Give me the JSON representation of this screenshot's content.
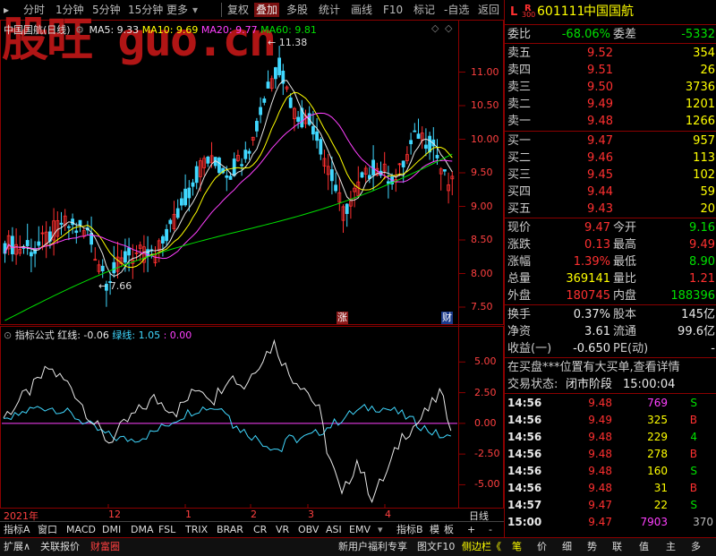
{
  "toolbar": {
    "items": [
      "分时",
      "1分钟",
      "5分钟",
      "15分钟",
      "更多",
      "复权",
      "叠加",
      "多股",
      "统计",
      "画线",
      "F10",
      "标记",
      "-自选",
      "返回"
    ]
  },
  "kline": {
    "title": "中国国航(日线)",
    "ma5": "MA5: 9.33",
    "ma10": "MA10: 9.69",
    "ma20": "MA20: 9.77",
    "ma60": "MA60: 9.81",
    "high_mark": "11.38",
    "low_mark": "7.66",
    "y_ticks": [
      "11.00",
      "10.50",
      "10.00",
      "9.50",
      "9.00",
      "8.50",
      "8.00",
      "7.50"
    ],
    "badge_zhang": "涨",
    "badge_cai": "财",
    "watermark": "股旺 guo.cn"
  },
  "indicator": {
    "name": "指标公式",
    "red_line": "红线: -0.06",
    "green_line": "绿线: 1.05",
    "zero_value": ": 0.00",
    "y_ticks": [
      "5.00",
      "2.50",
      "0.00",
      "-2.50",
      "-5.00"
    ]
  },
  "time_axis": {
    "labels": [
      "2021年",
      "12",
      "1",
      "2",
      "3",
      "4"
    ],
    "period": "日线"
  },
  "tabs_row1": [
    "指标A",
    "窗口",
    "MACD",
    "DMI",
    "DMA",
    "FSL",
    "TRIX",
    "BRAR",
    "CR",
    "VR",
    "OBV",
    "ASI",
    "EMV",
    "指标B",
    "模",
    "板",
    "+",
    "-"
  ],
  "tabs_row2": [
    "扩展∧",
    "关联报价",
    "财富圈",
    "新用户福利专享",
    "图文F10",
    "侧边栏《",
    "笔",
    "价",
    "细",
    "势",
    "联",
    "值",
    "主",
    "多"
  ],
  "stock": {
    "flag_l": "L",
    "flag_r": "R",
    "flag_num": "300",
    "code": "601111",
    "name": "中国国航",
    "weibi_label": "委比",
    "weibi": "-68.06%",
    "weicha_label": "委差",
    "weicha": "-5332"
  },
  "asks": [
    {
      "label": "卖五",
      "price": "9.52",
      "vol": "354"
    },
    {
      "label": "卖四",
      "price": "9.51",
      "vol": "26"
    },
    {
      "label": "卖三",
      "price": "9.50",
      "vol": "3736"
    },
    {
      "label": "卖二",
      "price": "9.49",
      "vol": "1201"
    },
    {
      "label": "卖一",
      "price": "9.48",
      "vol": "1266"
    }
  ],
  "bids": [
    {
      "label": "买一",
      "price": "9.47",
      "vol": "957"
    },
    {
      "label": "买二",
      "price": "9.46",
      "vol": "113"
    },
    {
      "label": "买三",
      "price": "9.45",
      "vol": "102"
    },
    {
      "label": "买四",
      "price": "9.44",
      "vol": "59"
    },
    {
      "label": "买五",
      "price": "9.43",
      "vol": "20"
    }
  ],
  "quote": [
    {
      "l1": "现价",
      "v1": "9.47",
      "c1": "red",
      "l2": "今开",
      "v2": "9.16",
      "c2": "green"
    },
    {
      "l1": "涨跌",
      "v1": "0.13",
      "c1": "red",
      "l2": "最高",
      "v2": "9.49",
      "c2": "red"
    },
    {
      "l1": "涨幅",
      "v1": "1.39%",
      "c1": "red",
      "l2": "最低",
      "v2": "8.90",
      "c2": "green"
    },
    {
      "l1": "总量",
      "v1": "369141",
      "c1": "yellow",
      "l2": "量比",
      "v2": "1.21",
      "c2": "red"
    },
    {
      "l1": "外盘",
      "v1": "180745",
      "c1": "red",
      "l2": "内盘",
      "v2": "188396",
      "c2": "green"
    }
  ],
  "fund": [
    {
      "l1": "换手",
      "v1": "0.37%",
      "l2": "股本",
      "v2": "145亿"
    },
    {
      "l1": "净资",
      "v1": "3.61",
      "l2": "流通",
      "v2": "99.6亿"
    },
    {
      "l1": "收益(一)",
      "v1": "-0.650",
      "l2": "PE(动)",
      "v2": "-"
    }
  ],
  "notice": "在买盘***位置有大买单,查看详情",
  "trade_status_label": "交易状态:",
  "trade_status": "闭市阶段",
  "trade_time": "15:00:04",
  "ticks": [
    {
      "t": "14:56",
      "p": "9.48",
      "v": "769",
      "s": "S",
      "vc": "magenta",
      "sc": "green"
    },
    {
      "t": "14:56",
      "p": "9.49",
      "v": "325",
      "s": "B",
      "vc": "yellow",
      "sc": "red"
    },
    {
      "t": "14:56",
      "p": "9.48",
      "v": "229",
      "s": "4",
      "vc": "yellow",
      "sc": "green"
    },
    {
      "t": "14:56",
      "p": "9.48",
      "v": "278",
      "s": "B",
      "vc": "yellow",
      "sc": "red"
    },
    {
      "t": "14:56",
      "p": "9.48",
      "v": "160",
      "s": "S",
      "vc": "yellow",
      "sc": "green"
    },
    {
      "t": "14:56",
      "p": "9.48",
      "v": "31",
      "s": "B",
      "vc": "yellow",
      "sc": "red"
    },
    {
      "t": "14:57",
      "p": "9.47",
      "v": "22",
      "s": "S",
      "vc": "yellow",
      "sc": "green"
    },
    {
      "t": "15:00",
      "p": "9.47",
      "v": "7903",
      "s": "370",
      "vc": "magenta",
      "sc": "white"
    }
  ],
  "chart_data": {
    "type": "line",
    "kline": {
      "ylim": [
        7.3,
        11.7
      ],
      "ticks": [
        11.0,
        10.5,
        10.0,
        9.5,
        9.0,
        8.5,
        8.0,
        7.5
      ],
      "high": 11.38,
      "low": 7.66
    },
    "indicator": {
      "ylim": [
        -6.5,
        7.5
      ],
      "ticks": [
        5.0,
        2.5,
        0.0,
        -2.5,
        -5.0
      ],
      "series": [
        {
          "name": "红线",
          "values": [
            -0.06
          ]
        },
        {
          "name": "绿线",
          "values": [
            1.05
          ]
        }
      ]
    }
  }
}
